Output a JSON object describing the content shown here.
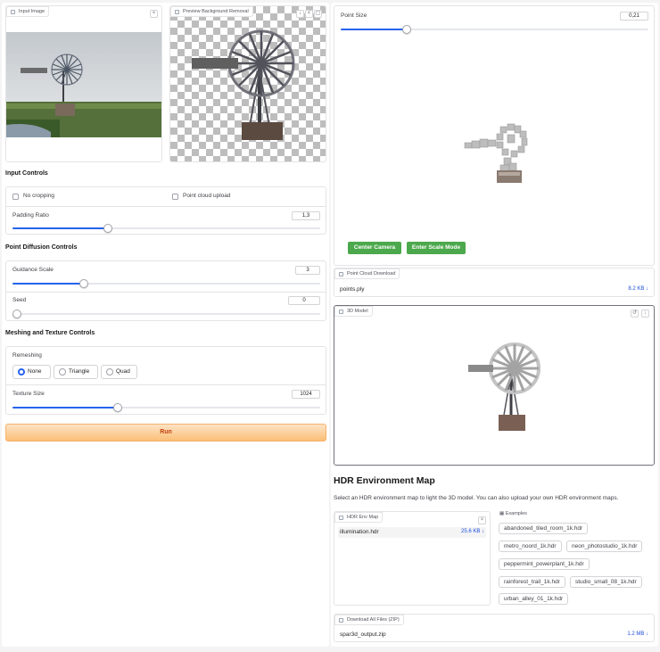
{
  "input_image": {
    "label": "Input Image"
  },
  "preview": {
    "label": "Preview Background Removal"
  },
  "input_controls": {
    "title": "Input Controls",
    "no_cropping": "No cropping",
    "point_cloud_upload": "Point cloud upload",
    "padding_ratio": {
      "label": "Padding Ratio",
      "value": "1,3",
      "fraction": 0.3
    }
  },
  "diffusion": {
    "title": "Point Diffusion Controls",
    "guidance": {
      "label": "Guidance Scale",
      "value": "3",
      "fraction": 0.23
    },
    "seed": {
      "label": "Seed",
      "value": "0",
      "fraction": 0.0
    }
  },
  "meshing": {
    "title": "Meshing and Texture Controls",
    "remeshing_label": "Remeshing",
    "options": [
      "None",
      "Triangle",
      "Quad"
    ],
    "selected": "None",
    "texture_size": {
      "label": "Texture Size",
      "value": "1024",
      "fraction": 0.33
    }
  },
  "run_button": "Run",
  "point_size": {
    "label": "Point Size",
    "value": "0,21",
    "fraction": 0.2
  },
  "viewer_buttons": {
    "center": "Center Camera",
    "scale": "Enter Scale Mode"
  },
  "point_cloud_download": {
    "label": "Point Cloud Download",
    "file": "points.ply",
    "size": "8.2 KB ↓"
  },
  "model3d": {
    "label": "3D Model"
  },
  "hdr": {
    "title": "HDR Environment Map",
    "description": "Select an HDR environment map to light the 3D model. You can also upload your own HDR environment maps.",
    "env_label": "HDR Env Map",
    "file": "illumination.hdr",
    "size": "25.6 KB ↓",
    "examples_label": "Examples",
    "examples": [
      "abandoned_tiled_room_1k.hdr",
      "metro_noord_1k.hdr",
      "neon_photostudio_1k.hdr",
      "peppermint_powerplant_1k.hdr",
      "rainforest_trail_1k.hdr",
      "studio_small_08_1k.hdr",
      "urban_alley_01_1k.hdr"
    ]
  },
  "download_all": {
    "label": "Download All Files (ZIP)",
    "file": "spar3d_output.zip",
    "size": "1.2 MB ↓"
  },
  "colors": {
    "accent": "#2563eb",
    "run_start": "#fdd9b5",
    "run_end": "#fbbf77",
    "green": "#4ca84c"
  }
}
